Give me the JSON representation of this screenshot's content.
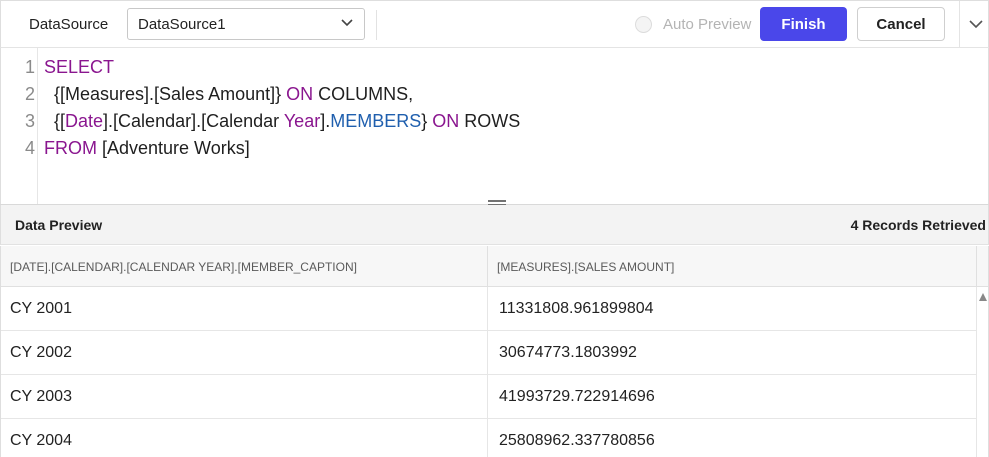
{
  "toolbar": {
    "datasource_label": "DataSource",
    "datasource_value": "DataSource1",
    "auto_preview_label": "Auto Preview",
    "finish_label": "Finish",
    "cancel_label": "Cancel",
    "accent_color": "#4a47ea"
  },
  "editor": {
    "line_numbers": [
      "1",
      "2",
      "3",
      "4"
    ],
    "line1": {
      "kw1": "SELECT"
    },
    "line2": {
      "t1": "  {[Measures].[Sales Amount]} ",
      "kw1": "ON",
      "t2": " COLUMNS,"
    },
    "line3": {
      "t1": "  {[",
      "kw1": "Date",
      "t2": "].[Calendar].[Calendar ",
      "kw2": "Year",
      "t3": "].",
      "fn1": "MEMBERS",
      "t4": "} ",
      "kw3": "ON",
      "t5": " ROWS"
    },
    "line4": {
      "kw1": "FROM",
      "t1": " [Adventure Works]"
    },
    "keyword_color": "#8a168f",
    "function_color": "#1f5fae"
  },
  "preview": {
    "title": "Data Preview",
    "records": "4 Records Retrieved",
    "columns": [
      "[DATE].[CALENDAR].[CALENDAR YEAR].[MEMBER_CAPTION]",
      "[MEASURES].[SALES AMOUNT]"
    ],
    "rows": [
      [
        "CY 2001",
        "11331808.961899804"
      ],
      [
        "CY 2002",
        "30674773.1803992"
      ],
      [
        "CY 2003",
        "41993729.722914696"
      ],
      [
        "CY 2004",
        "25808962.337780856"
      ]
    ]
  }
}
